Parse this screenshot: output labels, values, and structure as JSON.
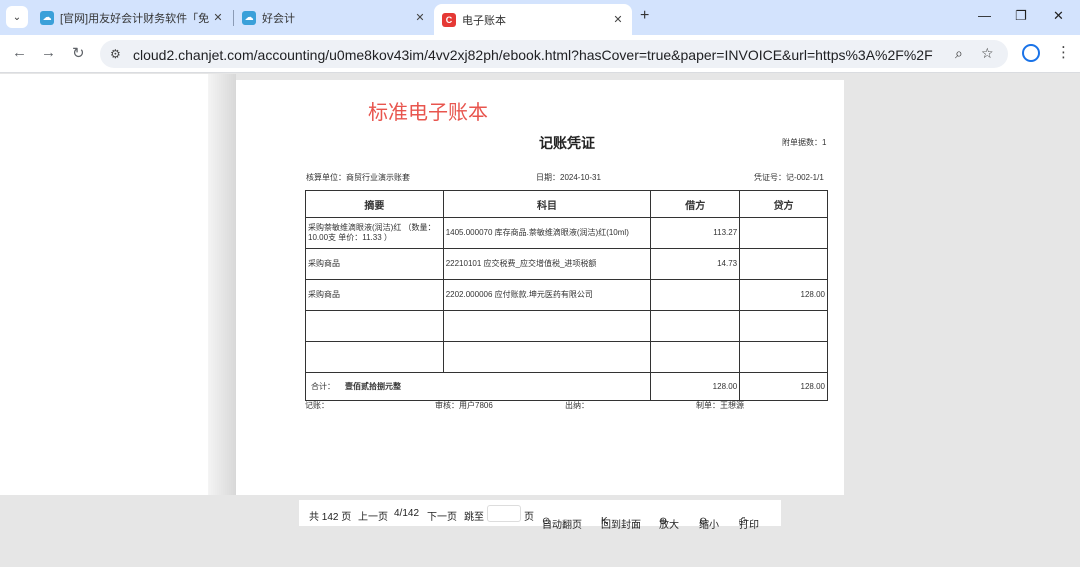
{
  "browser": {
    "tabs": [
      {
        "title": "[官网]用友好会计财务软件「免",
        "favicon": "cloud-icon"
      },
      {
        "title": "好会计",
        "favicon": "cloud-icon"
      },
      {
        "title": "电子账本",
        "favicon": "chanjet-logo-icon",
        "active": true
      }
    ],
    "url_host": "cloud2.chanjet.com",
    "url_path": "/accounting/u0me8kov43im/4vv2xj82ph/ebook.html?hasCover=true&paper=INVOICE&url=https%3A%2F%2Fcloudsto.sta..."
  },
  "page": {
    "ebook_title": "标准电子账本",
    "voucher_title": "记账凭证",
    "attachments": "附单据数：1",
    "unit": "核算单位：商贸行业演示账套",
    "date": "日期：2024-10-31",
    "voucher_no": "凭证号：记-002-1/1",
    "headers": [
      "摘要",
      "科目",
      "借方",
      "贷方"
    ],
    "rows": [
      {
        "summary": "采购萘敏维滴眼液(润洁)红 （数量：10.00支  单价：11.33 ）",
        "account": "1405.000070 库存商品.萘敏维滴眼液(润洁)红(10ml)",
        "debit": "113.27",
        "credit": ""
      },
      {
        "summary": "采购商品",
        "account": "22210101 应交税费_应交增值税_进项税额",
        "debit": "14.73",
        "credit": ""
      },
      {
        "summary": "采购商品",
        "account": "2202.000006 应付账款.坤元医药有限公司",
        "debit": "",
        "credit": "128.00"
      },
      {
        "summary": "",
        "account": "",
        "debit": "",
        "credit": ""
      },
      {
        "summary": "",
        "account": "",
        "debit": "",
        "credit": ""
      }
    ],
    "total_label": "合计：",
    "total_words": "壹佰贰拾捌元整",
    "total_debit": "128.00",
    "total_credit": "128.00",
    "bookkeeper": "记账：",
    "auditor": "审核：用户7806",
    "cashier": "出纳：",
    "maker": "制单：王想源"
  },
  "pager": {
    "total": "共 142 页",
    "prev": "上一页",
    "current": "4/142",
    "next": "下一页",
    "jump": "跳至",
    "page_unit": "页",
    "auto": "自动翻页",
    "cover": "回到封面",
    "zoom_in": "放大",
    "zoom_out": "缩小",
    "print": "打印"
  }
}
